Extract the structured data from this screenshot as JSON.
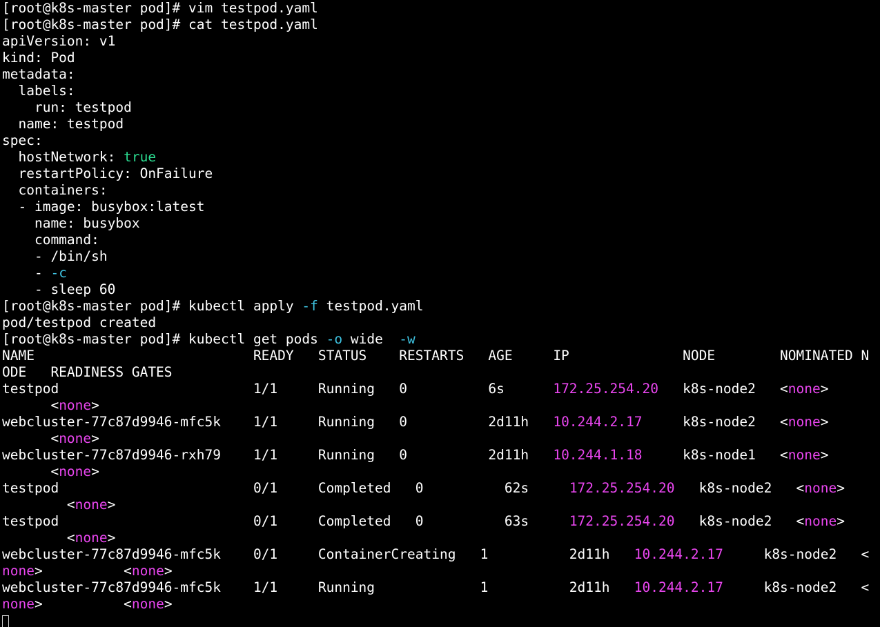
{
  "colors": {
    "background": "#000000",
    "text": "#ffffff",
    "flag": "#3ec2e0",
    "boolean": "#2bdc91",
    "ip_address": "#ea46f0",
    "none_value": "#ea46f0"
  },
  "terminal": {
    "lines": [
      {
        "kind": "prompt",
        "segments": [
          {
            "t": "[root@k8s-master pod]# ",
            "c": "plain"
          },
          {
            "t": "vim testpod.yaml",
            "c": "cmd"
          }
        ]
      },
      {
        "kind": "prompt",
        "segments": [
          {
            "t": "[root@k8s-master pod]# ",
            "c": "plain"
          },
          {
            "t": "cat testpod.yaml",
            "c": "cmd"
          }
        ]
      },
      {
        "kind": "yaml",
        "segments": [
          {
            "t": "apiVersion: v1",
            "c": "plain"
          }
        ]
      },
      {
        "kind": "yaml",
        "segments": [
          {
            "t": "kind: Pod",
            "c": "plain"
          }
        ]
      },
      {
        "kind": "yaml",
        "segments": [
          {
            "t": "metadata:",
            "c": "plain"
          }
        ]
      },
      {
        "kind": "yaml",
        "segments": [
          {
            "t": "  labels:",
            "c": "plain"
          }
        ]
      },
      {
        "kind": "yaml",
        "segments": [
          {
            "t": "    run: testpod",
            "c": "plain"
          }
        ]
      },
      {
        "kind": "yaml",
        "segments": [
          {
            "t": "  name: testpod",
            "c": "plain"
          }
        ]
      },
      {
        "kind": "yaml",
        "segments": [
          {
            "t": "spec:",
            "c": "plain"
          }
        ]
      },
      {
        "kind": "yaml",
        "segments": [
          {
            "t": "  hostNetwork: ",
            "c": "plain"
          },
          {
            "t": "true",
            "c": "bool"
          }
        ]
      },
      {
        "kind": "yaml",
        "segments": [
          {
            "t": "  restartPolicy: OnFailure",
            "c": "plain"
          }
        ]
      },
      {
        "kind": "yaml",
        "segments": [
          {
            "t": "  containers:",
            "c": "plain"
          }
        ]
      },
      {
        "kind": "yaml",
        "segments": [
          {
            "t": "  - image: busybox:latest",
            "c": "plain"
          }
        ]
      },
      {
        "kind": "yaml",
        "segments": [
          {
            "t": "    name: busybox",
            "c": "plain"
          }
        ]
      },
      {
        "kind": "yaml",
        "segments": [
          {
            "t": "    command:",
            "c": "plain"
          }
        ]
      },
      {
        "kind": "yaml",
        "segments": [
          {
            "t": "    - /bin/sh",
            "c": "plain"
          }
        ]
      },
      {
        "kind": "yaml",
        "segments": [
          {
            "t": "    - ",
            "c": "plain"
          },
          {
            "t": "-c",
            "c": "flag"
          }
        ]
      },
      {
        "kind": "yaml",
        "segments": [
          {
            "t": "    - sleep 60",
            "c": "plain"
          }
        ]
      },
      {
        "kind": "prompt",
        "segments": [
          {
            "t": "[root@k8s-master pod]# ",
            "c": "plain"
          },
          {
            "t": "kubectl apply ",
            "c": "cmd"
          },
          {
            "t": "-f",
            "c": "flag"
          },
          {
            "t": " testpod.yaml",
            "c": "cmd"
          }
        ]
      },
      {
        "kind": "output",
        "segments": [
          {
            "t": "pod/testpod created",
            "c": "plain"
          }
        ]
      },
      {
        "kind": "prompt",
        "segments": [
          {
            "t": "[root@k8s-master pod]# ",
            "c": "plain"
          },
          {
            "t": "kubectl get pods ",
            "c": "cmd"
          },
          {
            "t": "-o",
            "c": "flag"
          },
          {
            "t": " wide  ",
            "c": "cmd"
          },
          {
            "t": "-w",
            "c": "flag"
          }
        ]
      },
      {
        "kind": "header",
        "segments": [
          {
            "t": "NAME                           READY   STATUS    RESTARTS   AGE     IP              NODE        NOMINATED N",
            "c": "plain"
          }
        ]
      },
      {
        "kind": "header",
        "segments": [
          {
            "t": "ODE   READINESS GATES",
            "c": "plain"
          }
        ]
      },
      {
        "kind": "row",
        "segments": [
          {
            "t": "testpod                        1/1     Running   0          6s      ",
            "c": "plain"
          },
          {
            "t": "172.25.254.20",
            "c": "ip"
          },
          {
            "t": "   k8s-node2   <",
            "c": "plain"
          },
          {
            "t": "none",
            "c": "none"
          },
          {
            "t": ">",
            "c": "plain"
          }
        ]
      },
      {
        "kind": "row",
        "segments": [
          {
            "t": "      <",
            "c": "plain"
          },
          {
            "t": "none",
            "c": "none"
          },
          {
            "t": ">",
            "c": "plain"
          }
        ]
      },
      {
        "kind": "row",
        "segments": [
          {
            "t": "webcluster-77c87d9946-mfc5k    1/1     Running   0          2d11h   ",
            "c": "plain"
          },
          {
            "t": "10.244.2.17",
            "c": "ip"
          },
          {
            "t": "     k8s-node2   <",
            "c": "plain"
          },
          {
            "t": "none",
            "c": "none"
          },
          {
            "t": ">",
            "c": "plain"
          }
        ]
      },
      {
        "kind": "row",
        "segments": [
          {
            "t": "      <",
            "c": "plain"
          },
          {
            "t": "none",
            "c": "none"
          },
          {
            "t": ">",
            "c": "plain"
          }
        ]
      },
      {
        "kind": "row",
        "segments": [
          {
            "t": "webcluster-77c87d9946-rxh79    1/1     Running   0          2d11h   ",
            "c": "plain"
          },
          {
            "t": "10.244.1.18",
            "c": "ip"
          },
          {
            "t": "     k8s-node1   <",
            "c": "plain"
          },
          {
            "t": "none",
            "c": "none"
          },
          {
            "t": ">",
            "c": "plain"
          }
        ]
      },
      {
        "kind": "row",
        "segments": [
          {
            "t": "      <",
            "c": "plain"
          },
          {
            "t": "none",
            "c": "none"
          },
          {
            "t": ">",
            "c": "plain"
          }
        ]
      },
      {
        "kind": "row",
        "segments": [
          {
            "t": "testpod                        0/1     Completed   0          62s     ",
            "c": "plain"
          },
          {
            "t": "172.25.254.20",
            "c": "ip"
          },
          {
            "t": "   k8s-node2   <",
            "c": "plain"
          },
          {
            "t": "none",
            "c": "none"
          },
          {
            "t": ">",
            "c": "plain"
          }
        ]
      },
      {
        "kind": "row",
        "segments": [
          {
            "t": "        <",
            "c": "plain"
          },
          {
            "t": "none",
            "c": "none"
          },
          {
            "t": ">",
            "c": "plain"
          }
        ]
      },
      {
        "kind": "row",
        "segments": [
          {
            "t": "testpod                        0/1     Completed   0          63s     ",
            "c": "plain"
          },
          {
            "t": "172.25.254.20",
            "c": "ip"
          },
          {
            "t": "   k8s-node2   <",
            "c": "plain"
          },
          {
            "t": "none",
            "c": "none"
          },
          {
            "t": ">",
            "c": "plain"
          }
        ]
      },
      {
        "kind": "row",
        "segments": [
          {
            "t": "        <",
            "c": "plain"
          },
          {
            "t": "none",
            "c": "none"
          },
          {
            "t": ">",
            "c": "plain"
          }
        ]
      },
      {
        "kind": "row",
        "segments": [
          {
            "t": "webcluster-77c87d9946-mfc5k    0/1     ContainerCreating   1          2d11h   ",
            "c": "plain"
          },
          {
            "t": "10.244.2.17",
            "c": "ip"
          },
          {
            "t": "     k8s-node2   <",
            "c": "plain"
          }
        ]
      },
      {
        "kind": "row",
        "segments": [
          {
            "t": "none",
            "c": "none"
          },
          {
            "t": ">          <",
            "c": "plain"
          },
          {
            "t": "none",
            "c": "none"
          },
          {
            "t": ">",
            "c": "plain"
          }
        ]
      },
      {
        "kind": "row",
        "segments": [
          {
            "t": "webcluster-77c87d9946-mfc5k    1/1     Running             1          2d11h   ",
            "c": "plain"
          },
          {
            "t": "10.244.2.17",
            "c": "ip"
          },
          {
            "t": "     k8s-node2   <",
            "c": "plain"
          }
        ]
      },
      {
        "kind": "row",
        "segments": [
          {
            "t": "none",
            "c": "none"
          },
          {
            "t": ">          <",
            "c": "plain"
          },
          {
            "t": "none",
            "c": "none"
          },
          {
            "t": ">",
            "c": "plain"
          }
        ]
      }
    ]
  }
}
